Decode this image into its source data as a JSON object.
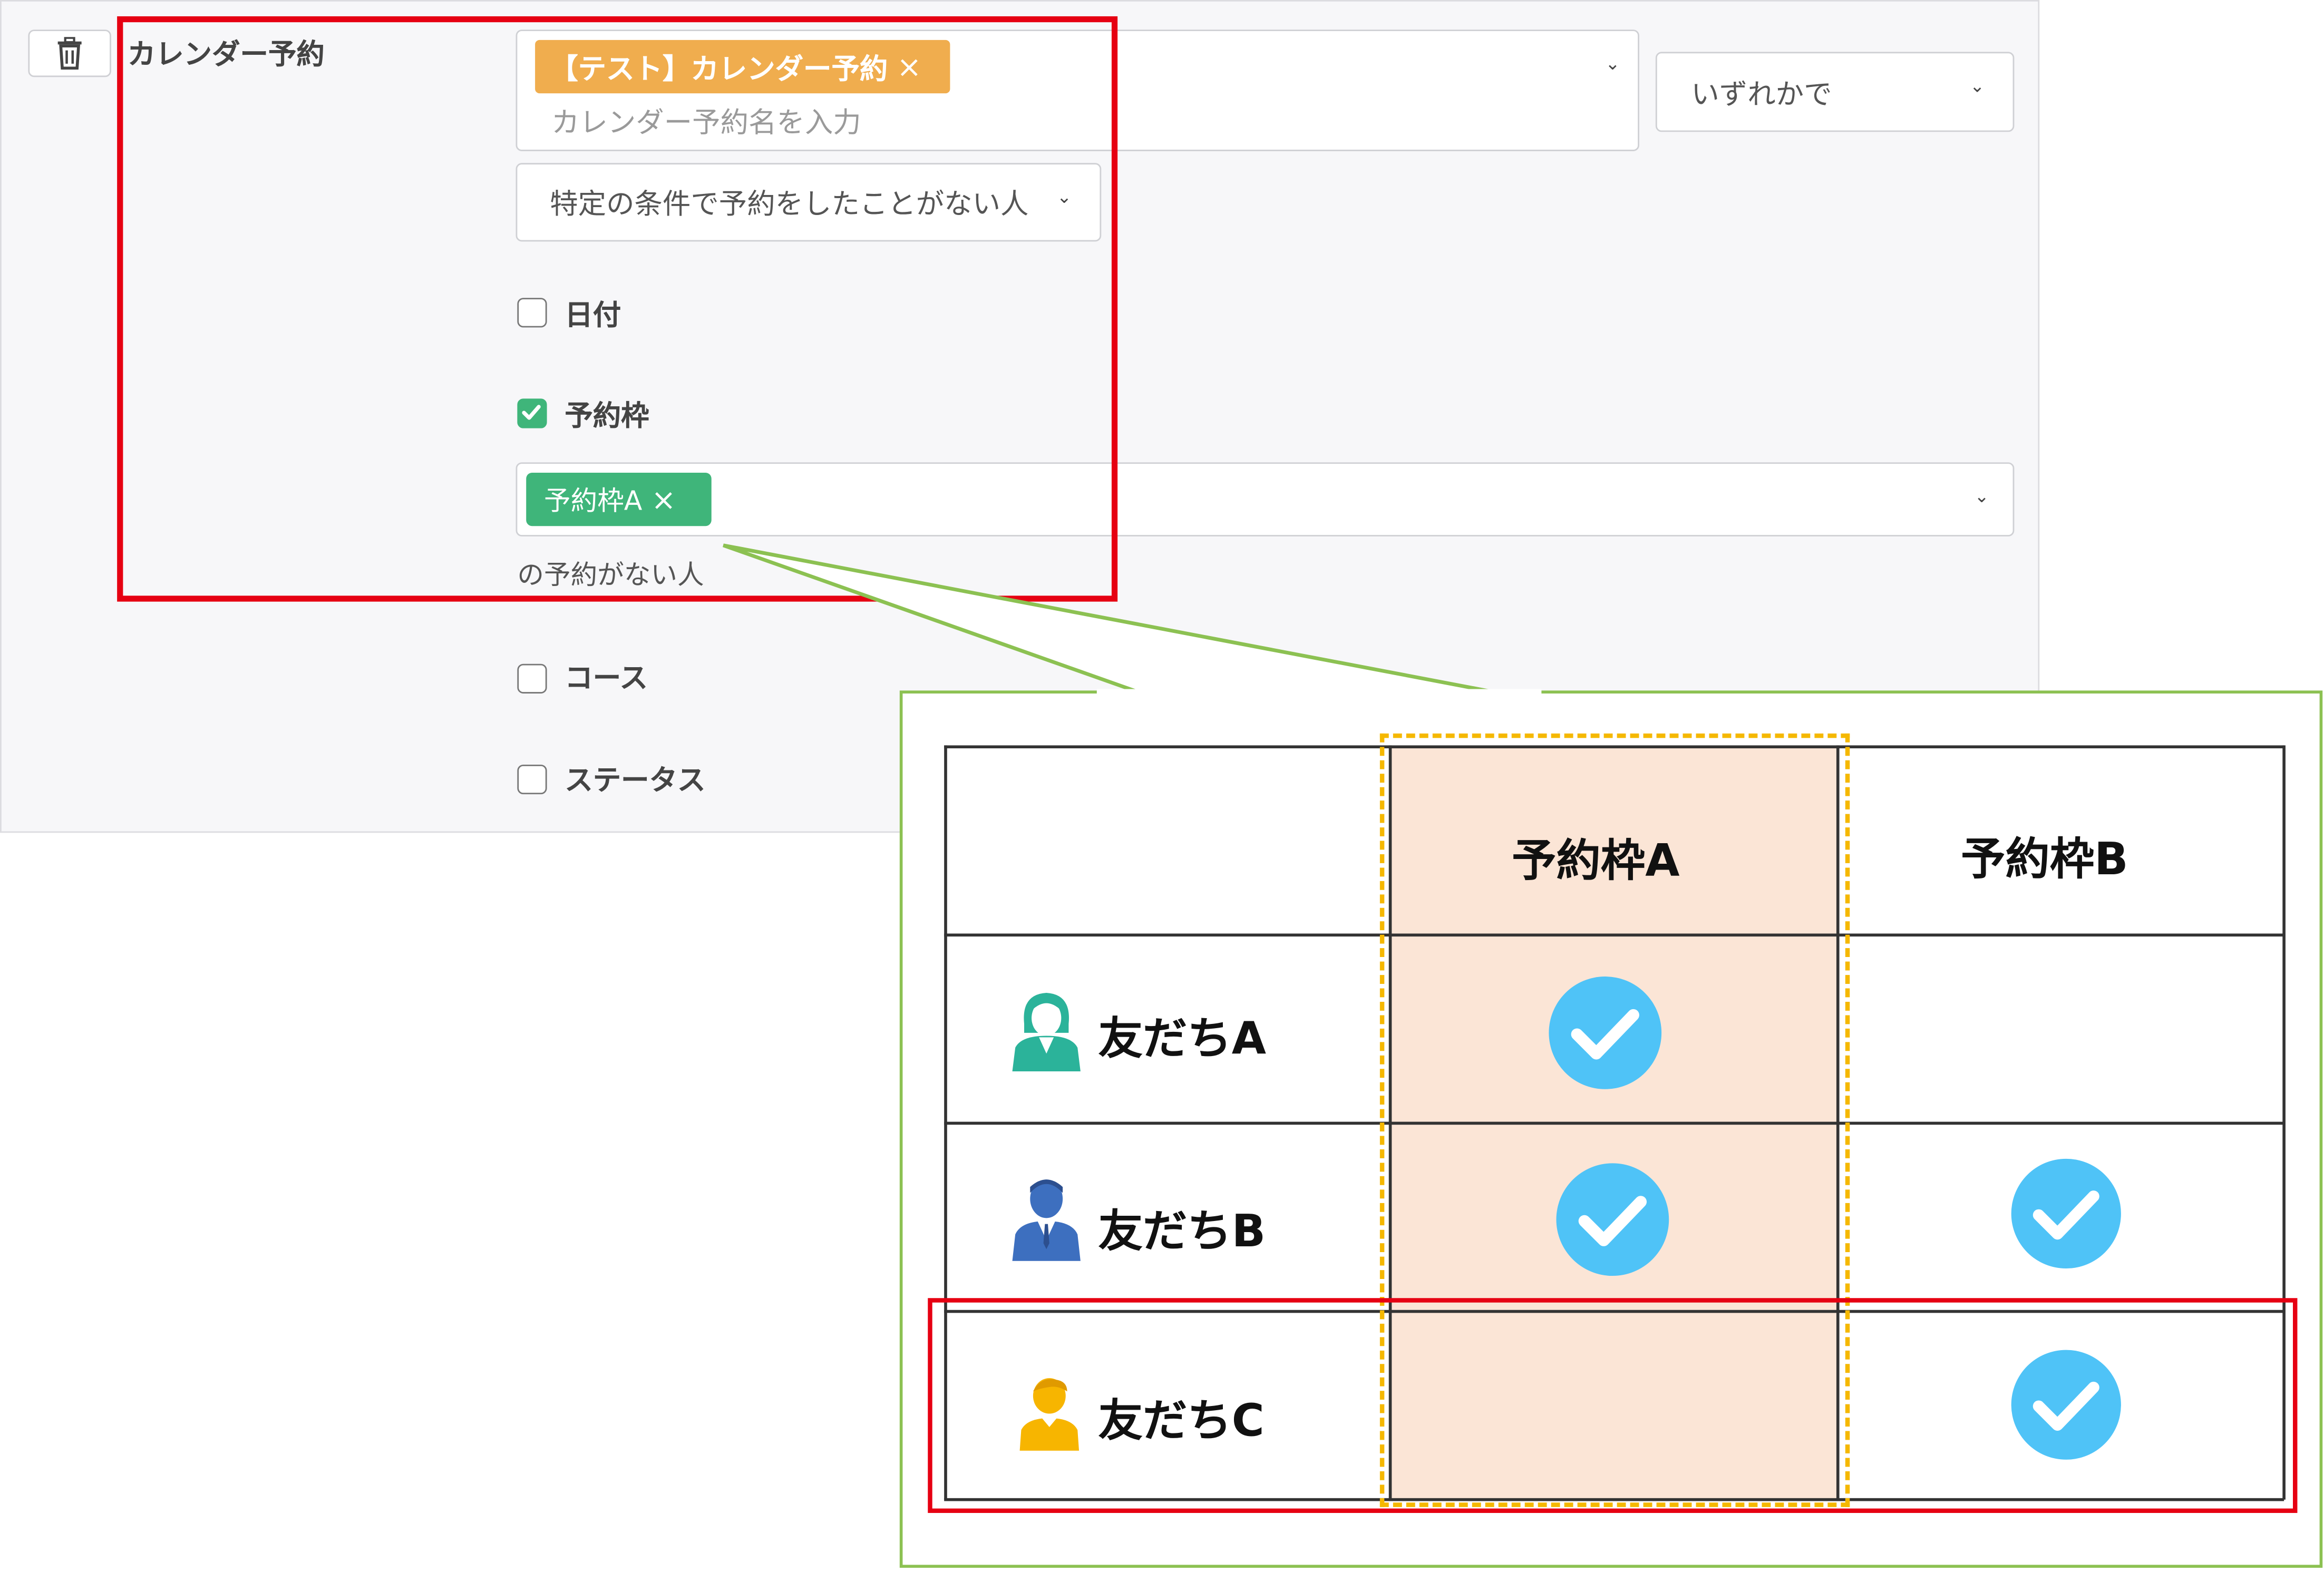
{
  "form": {
    "field_label": "カレンダー予約",
    "calendar_tag": "【テスト】カレンダー予約",
    "tag_remove": "×",
    "calendar_placeholder": "カレンダー予約名を入力",
    "match_mode": "いずれかで",
    "condition_select": "特定の条件で予約をしたことがない人",
    "checkbox_date": {
      "label": "日付",
      "checked": false
    },
    "checkbox_slot": {
      "label": "予約枠",
      "checked": true
    },
    "slot_tag": "予約枠A",
    "slot_help": "の予約がない人",
    "checkbox_course": {
      "label": "コース",
      "checked": false
    },
    "checkbox_status": {
      "label": "ステータス",
      "checked": false
    }
  },
  "example_table": {
    "columns": [
      "予約枠A",
      "予約枠B"
    ],
    "rows": [
      {
        "name": "友だちA",
        "icon": "woman-avatar-icon",
        "slot_a": true,
        "slot_b": false
      },
      {
        "name": "友だちB",
        "icon": "man-suit-avatar-icon",
        "slot_a": true,
        "slot_b": true
      },
      {
        "name": "友だちC",
        "icon": "boy-avatar-icon",
        "slot_a": false,
        "slot_b": true
      }
    ]
  },
  "colors": {
    "tag_orange": "#f0ad4e",
    "tag_green": "#3fb57a",
    "highlight_red": "#e60012",
    "callout_green": "#8cc152",
    "column_highlight": "#fbe5d6",
    "dashed_yellow": "#f5b800",
    "check_blue": "#4fc3f7"
  }
}
